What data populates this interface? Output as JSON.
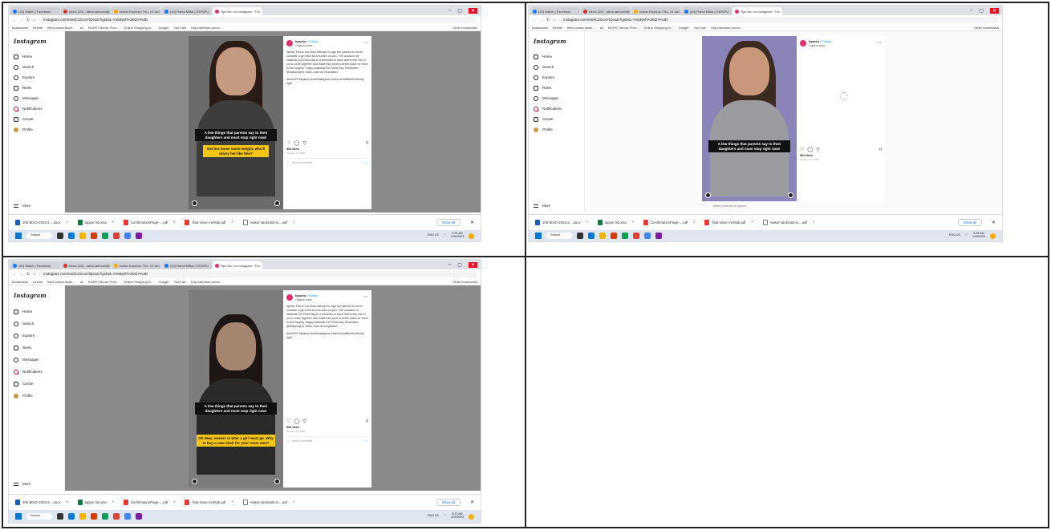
{
  "browser": {
    "tabs": [
      "(20) Watch | Facebook",
      "Inbox (20) - rahul.rahmosil@",
      "Indian Express: Thu, 19 Jan",
      "(10) Rahul Mittal | GGSIPU",
      "Tips Nio on Instagram: \"Thu"
    ],
    "url": "instagram.com/reel/CZGo47tQsxa/?igshid=YmMyMTA2M2Y%3D",
    "bookmarks": [
      "Bookmarks",
      "nevtab",
      "https://www.faceb...",
      "ull",
      "NCERT Books Free...",
      "Online Shopping fo...",
      "Google",
      "YouTube",
      "http://akhtnav.comm..."
    ],
    "other_bookmarks": "Other bookmarks"
  },
  "instagram": {
    "logo": "Instagram",
    "nav": [
      "Home",
      "Search",
      "Explore",
      "Reels",
      "Messages",
      "Notifications",
      "Create",
      "Profile"
    ],
    "more": "More"
  },
  "post": {
    "username": "tipsnio",
    "follow": "Follow",
    "audio": "Original audio",
    "caption": "tipsnio This is our short attempt to urge the parents to never consider a girl child as a burden on you. The occasion of National Girl Child Day is a reminder to each and every one of us to come together and make this world a better place for them to live happily. Happy National Girl Child Day. Recreated @dollysingh's video, such an inspiration.",
    "hashtags": "#nio2022 #tipsnio #reelsinstagram #reels #reelitfeelit #trendy #girl",
    "likes": "554 likes",
    "date": "January 24, 2022",
    "comment_placeholder": "Add a comment...",
    "post_label": "Post",
    "more_posts": "More posts from tipsnio"
  },
  "captions": {
    "main": "A few things that parents say to their daughters and must stop right now!",
    "s1": "Get her loose some weight, who'll marry her like this?",
    "s3": "Oh dear, sooner or later a girl must go. Why to buy a new chair for your room now?"
  },
  "downloads": [
    "105 BDIO-2022-2....docx",
    "topper list.xlsx",
    "ConfirmationPage-....pdf",
    "final-issue mehtab.pdf",
    "makar-sankranti-si....avif"
  ],
  "show_all": "Show all",
  "taskbar": {
    "search": "Search",
    "lang": "ENG US",
    "times": [
      "5:35 AM",
      "5:36 AM",
      "5:37 AM"
    ],
    "date": "1/19/2023"
  }
}
